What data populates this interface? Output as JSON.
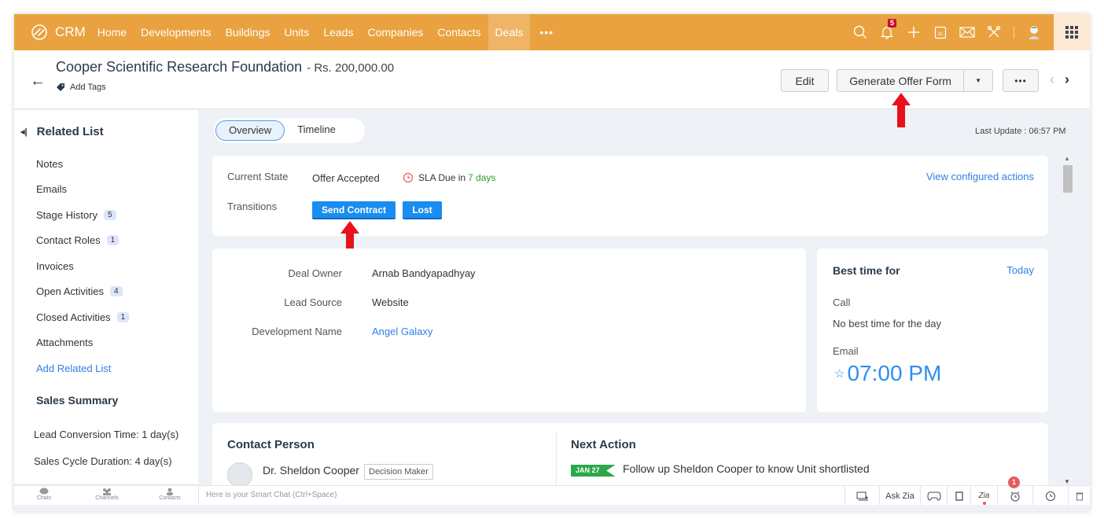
{
  "app": {
    "logo_text": "CRM",
    "accent_color": "#e9a23f"
  },
  "topnav": {
    "items": [
      {
        "label": "Home",
        "active": false
      },
      {
        "label": "Developments",
        "active": false
      },
      {
        "label": "Buildings",
        "active": false
      },
      {
        "label": "Units",
        "active": false
      },
      {
        "label": "Leads",
        "active": false
      },
      {
        "label": "Companies",
        "active": false
      },
      {
        "label": "Contacts",
        "active": false
      },
      {
        "label": "Deals",
        "active": true
      }
    ],
    "more_label": "•••",
    "notification_count": "5",
    "icons": [
      "search-icon",
      "bell-icon",
      "plus-icon",
      "calendar-icon",
      "mail-icon",
      "tools-icon",
      "avatar-icon",
      "apps-grid-icon"
    ]
  },
  "header": {
    "back_label": "←",
    "title": "Cooper Scientific Research Foundation",
    "amount": "- Rs. 200,000.00",
    "add_tags": "Add Tags",
    "edit_label": "Edit",
    "generate_offer_label": "Generate Offer Form",
    "more_label": "•••",
    "prev": "‹",
    "next": "›"
  },
  "sidebar": {
    "related_title": "Related List",
    "items": [
      {
        "label": "Notes",
        "count": null
      },
      {
        "label": "Emails",
        "count": null
      },
      {
        "label": "Stage History",
        "count": "5"
      },
      {
        "label": "Contact Roles",
        "count": "1"
      },
      {
        "label": "Invoices",
        "count": null
      },
      {
        "label": "Open Activities",
        "count": "4"
      },
      {
        "label": "Closed Activities",
        "count": "1"
      },
      {
        "label": "Attachments",
        "count": null
      }
    ],
    "add_related": "Add Related List",
    "sales_summary_title": "Sales Summary",
    "lead_conversion": "Lead Conversion Time: 1 day(s)",
    "sales_cycle": "Sales Cycle Duration: 4 day(s)"
  },
  "tabs": {
    "overview": "Overview",
    "timeline": "Timeline",
    "last_update": "Last Update : 06:57 PM"
  },
  "state": {
    "current_state_label": "Current State",
    "current_state_value": "Offer Accepted",
    "sla_prefix": "SLA Due in",
    "sla_days": "7 days",
    "view_actions": "View configured actions",
    "transitions_label": "Transitions",
    "transitions": [
      "Send Contract",
      "Lost"
    ]
  },
  "info": {
    "rows": [
      {
        "key": "Deal Owner",
        "value": "Arnab Bandyapadhyay",
        "link": false
      },
      {
        "key": "Lead Source",
        "value": "Website",
        "link": false
      },
      {
        "key": "Development Name",
        "value": "Angel Galaxy",
        "link": true
      }
    ]
  },
  "best_time": {
    "title": "Best time for",
    "today": "Today",
    "call_label": "Call",
    "call_value": "No best time for the day",
    "email_label": "Email",
    "email_value": "07:00 PM"
  },
  "contact": {
    "title": "Contact Person",
    "name": "Dr. Sheldon Cooper",
    "role": "Decision Maker"
  },
  "next_action": {
    "title": "Next Action",
    "date": "JAN 27",
    "text": "Follow up Sheldon Cooper to know Unit shortlisted"
  },
  "bottombar": {
    "chats": "Chats",
    "channels": "Channels",
    "contacts": "Contacts",
    "smart_chat_placeholder": "Here is your Smart Chat (Ctrl+Space)",
    "ask_zia": "Ask Zia",
    "alarm_count": "1"
  }
}
